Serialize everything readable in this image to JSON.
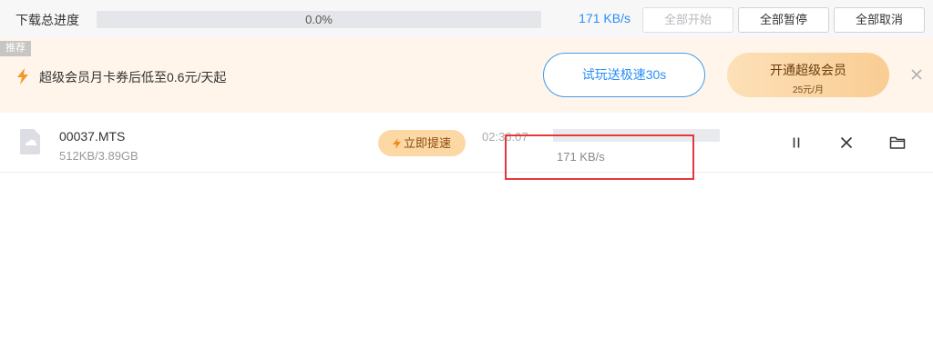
{
  "toolbar": {
    "progress_label": "下载总进度",
    "progress_percent": "0.0%",
    "progress_fraction": 0.0,
    "speed": "171 KB/s",
    "start_all": "全部开始",
    "pause_all": "全部暂停",
    "cancel_all": "全部取消"
  },
  "promo": {
    "tag": "推荐",
    "text": "超级会员月卡券后低至0.6元/天起",
    "trial_button": "试玩送极速30s",
    "vip_button": "开通超级会员",
    "vip_price": "25元/月"
  },
  "downloads": [
    {
      "name": "00037.MTS",
      "size": "512KB/3.89GB",
      "boost_label": "立即提速",
      "time_left": "02:36:07",
      "speed": "171 KB/s",
      "progress_fraction": 0.0
    }
  ],
  "colors": {
    "accent": "#2b8ff6",
    "promo_bg": "#fff5ea",
    "vip_gold": "#f9cd93",
    "annotation_red": "#e4393c"
  }
}
